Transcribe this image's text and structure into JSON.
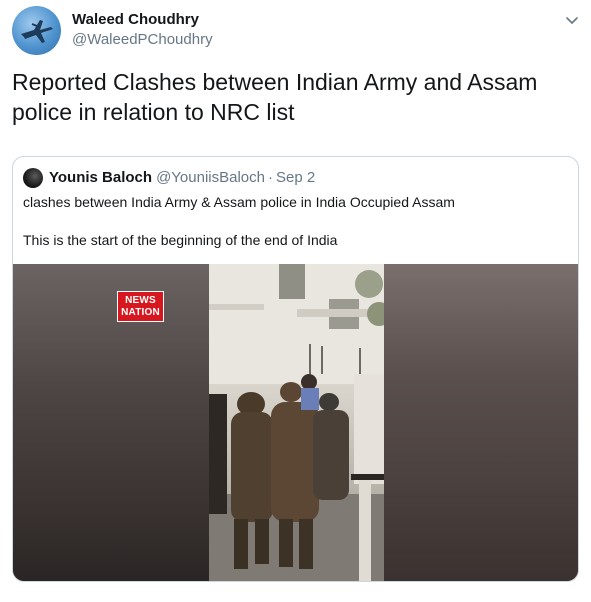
{
  "author": {
    "display_name": "Waleed Choudhry",
    "handle": "@WaleedPChoudhry",
    "avatar_icon": "jet-fighter-icon"
  },
  "tweet_text": "Reported Clashes between Indian Army and Assam police in relation to NRC list",
  "quoted_tweet": {
    "display_name": "Younis Baloch",
    "handle": "@YouniisBaloch",
    "separator": "·",
    "date": "Sep 2",
    "line1": "clashes between India Army & Assam police in India Occupied Assam",
    "line2": "This is the start of the beginning of the end of India",
    "video": {
      "badge_line1": "NEWS",
      "badge_line2": "NATION"
    }
  },
  "colors": {
    "secondary_text": "#657786",
    "border": "#ccd6dd",
    "badge_red": "#d6171f"
  }
}
